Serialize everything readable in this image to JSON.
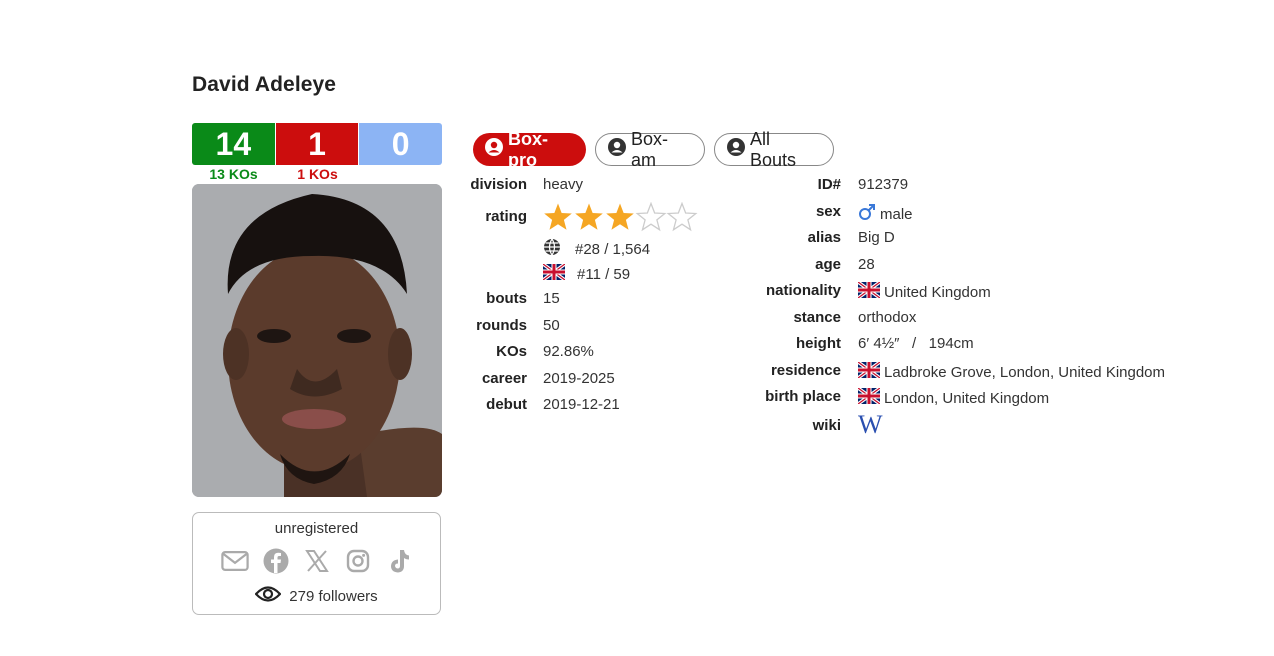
{
  "boxer": {
    "name": "David Adeleye",
    "record": {
      "wins": "14",
      "losses": "1",
      "draws": "0",
      "win_kos": "13 KOs",
      "loss_kos": "1 KOs"
    }
  },
  "social": {
    "status": "unregistered",
    "icons": [
      "email-icon",
      "facebook-icon",
      "x-icon",
      "instagram-icon",
      "tiktok-icon"
    ],
    "followers": "279 followers"
  },
  "tabs": [
    {
      "label": "Box-pro",
      "active": true
    },
    {
      "label": "Box-am",
      "active": false
    },
    {
      "label": "All Bouts",
      "active": false
    }
  ],
  "left_fields": {
    "division": {
      "label": "division",
      "value": "heavy"
    },
    "rating": {
      "label": "rating",
      "stars": 3,
      "max_stars": 5
    },
    "world_rank": "#28 / 1,564",
    "country_rank": "#11 / 59",
    "bouts": {
      "label": "bouts",
      "value": "15"
    },
    "rounds": {
      "label": "rounds",
      "value": "50"
    },
    "kos": {
      "label": "KOs",
      "value": "92.86%"
    },
    "career": {
      "label": "career",
      "value": "2019-2025"
    },
    "debut": {
      "label": "debut",
      "value": "2019-12-21"
    }
  },
  "right_fields": {
    "id": {
      "label": "ID#",
      "value": "912379"
    },
    "sex": {
      "label": "sex",
      "value": "male"
    },
    "alias": {
      "label": "alias",
      "value": "Big D"
    },
    "age": {
      "label": "age",
      "value": "28"
    },
    "nationality": {
      "label": "nationality",
      "value": "United Kingdom"
    },
    "stance": {
      "label": "stance",
      "value": "orthodox"
    },
    "height": {
      "label": "height",
      "value": "6′ 4½″   /   194cm"
    },
    "residence": {
      "label": "residence",
      "value": "Ladbroke Grove, London, United Kingdom"
    },
    "birth_place": {
      "label": "birth place",
      "value": "London, United Kingdom"
    },
    "wiki": {
      "label": "wiki",
      "value": "W"
    }
  },
  "colors": {
    "win": "#0a8a18",
    "loss": "#cc0d0d",
    "draw": "#8cb4f4",
    "star": "#f5a623"
  }
}
